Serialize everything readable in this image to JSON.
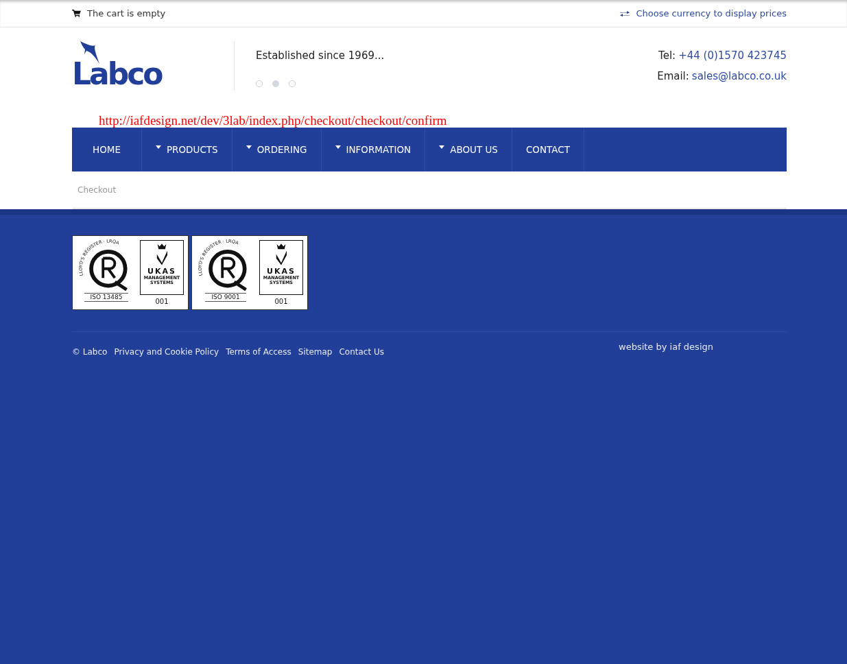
{
  "top_bar": {
    "cart_text": "The cart is empty",
    "currency_link": "Choose currency to display prices"
  },
  "header": {
    "logo_text": "Labco",
    "tagline": "Established since 1969...",
    "slider_dots": [
      {
        "selected": false
      },
      {
        "selected": true
      },
      {
        "selected": false
      }
    ],
    "contact": [
      {
        "label": "Tel:",
        "value": "+44 (0)1570 423745"
      },
      {
        "label": "Email:",
        "value": "sales@labco.co.uk"
      }
    ]
  },
  "page_url": "http://iafdesign.net/dev/3lab/index.php/checkout/checkout/confirm",
  "nav": [
    {
      "label": "HOME",
      "dropdown": false
    },
    {
      "label": "PRODUCTS",
      "dropdown": true
    },
    {
      "label": "ORDERING",
      "dropdown": true
    },
    {
      "label": "INFORMATION",
      "dropdown": true
    },
    {
      "label": "ABOUT US",
      "dropdown": true
    },
    {
      "label": "CONTACT",
      "dropdown": false
    }
  ],
  "breadcrumb": "Checkout",
  "certificates": [
    {
      "register": "LLOYD'S REGISTER · LRQA",
      "standard": "ISO 13485",
      "body": "UKAS",
      "body_sub": "MANAGEMENT SYSTEMS",
      "number": "001"
    },
    {
      "register": "LLOYD'S REGISTER · LRQA",
      "standard": "ISO 9001",
      "body": "UKAS",
      "body_sub": "MANAGEMENT SYSTEMS",
      "number": "001"
    }
  ],
  "footer": {
    "links": [
      "© Labco",
      "Privacy and Cookie Policy",
      "Terms of Access",
      "Sitemap",
      "Contact Us"
    ],
    "credit": "website by iaf design"
  }
}
